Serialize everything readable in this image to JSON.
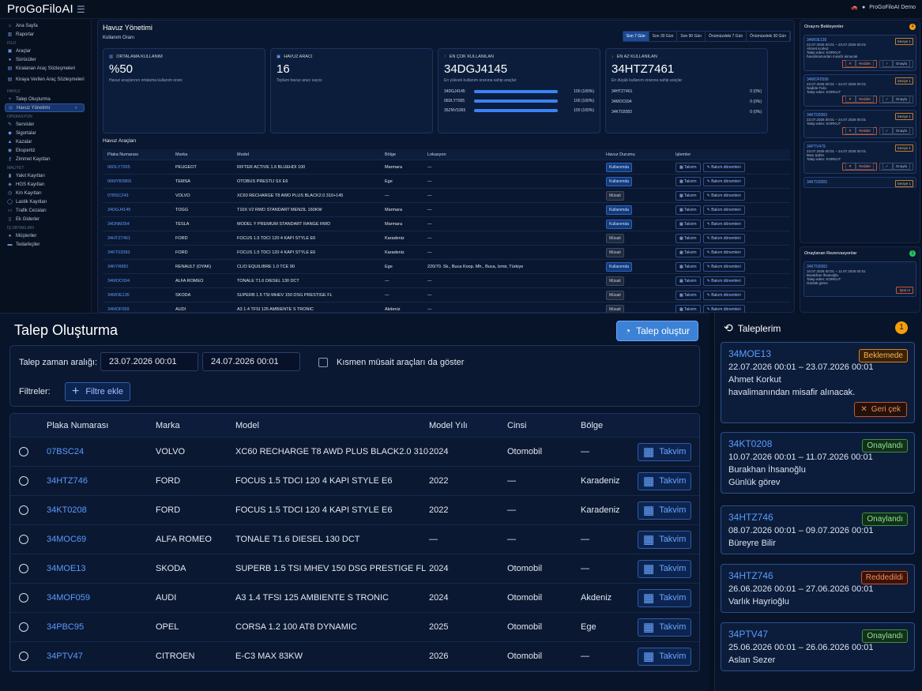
{
  "app": {
    "brand": "ProGoFiloAI",
    "user": "ProGoFiloAI Demo"
  },
  "sidebar": {
    "items": [
      {
        "type": "item",
        "label": "Ana Sayfa",
        "icon": "home-icon"
      },
      {
        "type": "item",
        "label": "Raporlar",
        "icon": "chart-icon"
      },
      {
        "type": "section",
        "label": "FİLO"
      },
      {
        "type": "item",
        "label": "Araçlar",
        "icon": "car-icon"
      },
      {
        "type": "item",
        "label": "Sürücüler",
        "icon": "user-icon"
      },
      {
        "type": "item",
        "label": "Kiralanan Araç Sözleşmeleri",
        "icon": "doc-icon"
      },
      {
        "type": "item2",
        "label": "Kiraya Verilen Araç Sözleşmeleri",
        "icon": "doc-icon"
      },
      {
        "type": "section",
        "label": "HAVUZ"
      },
      {
        "type": "item",
        "label": "Talep Oluşturma",
        "icon": "plus-icon"
      },
      {
        "type": "active",
        "label": "Havuz Yönetimi",
        "icon": "pool-icon"
      },
      {
        "type": "section",
        "label": "OPERASYON"
      },
      {
        "type": "item",
        "label": "Servisler",
        "icon": "wrench-icon"
      },
      {
        "type": "item",
        "label": "Sigortalar",
        "icon": "shield-icon"
      },
      {
        "type": "item",
        "label": "Kazalar",
        "icon": "alert-icon"
      },
      {
        "type": "item",
        "label": "Ekspertiz",
        "icon": "search-icon"
      },
      {
        "type": "item",
        "label": "Zimmet Kayıtları",
        "icon": "key-icon"
      },
      {
        "type": "section",
        "label": "MALİYET"
      },
      {
        "type": "item",
        "label": "Yakıt Kayıtları",
        "icon": "fuel-icon"
      },
      {
        "type": "item",
        "label": "HGS Kayıtları",
        "icon": "toll-icon"
      },
      {
        "type": "item",
        "label": "Km Kayıtları",
        "icon": "gauge-icon"
      },
      {
        "type": "item",
        "label": "Lastik Kayıtları",
        "icon": "tire-icon"
      },
      {
        "type": "item",
        "label": "Trafik Cezaları",
        "icon": "ticket-icon"
      },
      {
        "type": "item",
        "label": "Ek Giderler",
        "icon": "receipt-icon"
      },
      {
        "type": "section",
        "label": "İŞ ORTAKLARI"
      },
      {
        "type": "item",
        "label": "Müşteriler",
        "icon": "users-icon"
      },
      {
        "type": "item",
        "label": "Tedarikçiler",
        "icon": "truck-icon"
      }
    ]
  },
  "havuz": {
    "title": "Havuz Yönetimi",
    "subtitle": "Kullanım Oranı",
    "ranges": [
      "Son 7 Gün",
      "Son 30 Gün",
      "Son 90 Gün",
      "Önümüzdeki 7 Gün",
      "Önümüzdeki 30 Gün"
    ],
    "cards": [
      {
        "label": "ORTALAMA KULLANIM",
        "value": "%50",
        "sub": "Havuz araçlarının ortalama kullanım oranı",
        "icon": "bars-icon"
      },
      {
        "label": "HAVUZ ARACI",
        "value": "16",
        "sub": "Toplam havuz aracı sayısı",
        "icon": "car-icon"
      },
      {
        "label": "EN ÇOK KULLANILAN",
        "value": "34DGJ4145",
        "sub": "En yüksek kullanım oranına sahip araçlar",
        "icon": "arrow-up-icon"
      },
      {
        "label": "EN AZ KULLANILAN",
        "value": "34HTZ7461",
        "sub": "En düşük kullanım oranına sahip araçlar",
        "icon": "arrow-down-icon"
      }
    ],
    "top": [
      {
        "plate": "34DGJ4145",
        "pct": 100,
        "label": "100 (100%)"
      },
      {
        "plate": "06DLY7005",
        "pct": 100,
        "label": "100 (100%)"
      },
      {
        "plate": "35ZNVS365",
        "pct": 100,
        "label": "100 (100%)"
      }
    ],
    "low": [
      {
        "plate": "34HTZ7461",
        "label": "0 (0%)"
      },
      {
        "plate": "34MOC694",
        "label": "0 (0%)"
      },
      {
        "plate": "34KT02083",
        "label": "0 (0%)"
      }
    ],
    "table_title": "Havuz Araçları",
    "headers": [
      "Plaka Numarası",
      "Marka",
      "Model",
      "Bölge",
      "Lokasyon",
      "Havuz Durumu",
      "İşlemler"
    ],
    "btn_cal": "Takvim",
    "btn_maint": "Bakım dönemleri",
    "rows": [
      {
        "plate": "06DLY7005",
        "brand": "PEUGEOT",
        "model": "RIFTER ACTIVE 1.6 BLUEHDI 100",
        "region": "Marmara",
        "loc": "—",
        "status": "Kullanımda",
        "s": "k"
      },
      {
        "plate": "06MYB3865",
        "brand": "TEMSA",
        "model": "OTOBÜS PRESTIJ SX E6",
        "region": "Ege",
        "loc": "—",
        "status": "Kullanımda",
        "s": "k"
      },
      {
        "plate": "07BSC243",
        "brand": "VOLVO",
        "model": "XC60 RECHARGE T8 AWD PLUS BLACK2.0 310+145",
        "region": "—",
        "loc": "—",
        "status": "Müsait",
        "s": "m"
      },
      {
        "plate": "34DGJ4145",
        "brand": "TOGG",
        "model": "T10X V2 RWD STANDART MENZIL 160KW",
        "region": "Marmara",
        "loc": "—",
        "status": "Kullanımda",
        "s": "k"
      },
      {
        "plate": "34DNM354",
        "brand": "TESLA",
        "model": "MODEL Y PREMIUM STANDART RANGE RWD",
        "region": "Marmara",
        "loc": "—",
        "status": "Kullanımda",
        "s": "k"
      },
      {
        "plate": "34HTZ7461",
        "brand": "FORD",
        "model": "FOCUS 1.5 TDCI 120 4 KAPI STYLE E6",
        "region": "Karadeniz",
        "loc": "—",
        "status": "Müsait",
        "s": "m"
      },
      {
        "plate": "34KT02083",
        "brand": "FORD",
        "model": "FOCUS 1.5 TDCI 120 4 KAPI STYLE E6",
        "region": "Karadeniz",
        "loc": "—",
        "status": "Müsait",
        "s": "m"
      },
      {
        "plate": "34KYR881",
        "brand": "RENAULT (OYAK)",
        "model": "CLIO EQUILIBRE 1.0 TCE 90",
        "region": "Ege",
        "loc": "220/70. Sk., Buca Koop. Mh., Buca, İzmir, Türkiye",
        "status": "Kullanımda",
        "s": "k"
      },
      {
        "plate": "34MOC694",
        "brand": "ALFA ROMEO",
        "model": "TONALE T1.6 DIESEL 130 DCT",
        "region": "—",
        "loc": "—",
        "status": "Müsait",
        "s": "m"
      },
      {
        "plate": "34MOE135",
        "brand": "SKODA",
        "model": "SUPERB 1.5 TSI MHEV 150 DSG PRESTIGE FL",
        "region": "—",
        "loc": "—",
        "status": "Müsait",
        "s": "m"
      },
      {
        "plate": "34MOF059",
        "brand": "AUDI",
        "model": "A3 1.4 TFSI 125 AMBIENTE S TRONIC",
        "region": "Akdeniz",
        "loc": "—",
        "status": "Müsait",
        "s": "m"
      }
    ]
  },
  "side": {
    "pending_title": "Onayını Bekleyenler",
    "pending_count": "4",
    "pending": [
      {
        "plate": "34MOE135",
        "tag": "Seviye 1",
        "l1": "22.07.2026 00:01 – 23.07.2026 00:01",
        "l2": "Ahmet Korkut",
        "l3": "Talep eden: KORKUT",
        "l4": "havalimanından misafir alınacak."
      },
      {
        "plate": "34MOF0596",
        "tag": "Seviye 1",
        "l1": "23.07.2026 00:01 – 24.07.2026 00:01",
        "l2": "Nadide Falcı",
        "l3": "Talep eden: KORKUT",
        "l4": ""
      },
      {
        "plate": "34KT02083",
        "tag": "Seviye 1",
        "l1": "23.07.2026 00:01 – 24.07.2026 00:01",
        "l2": "Talep eden: KORKUT",
        "l3": "",
        "l4": ""
      },
      {
        "plate": "34PTV479",
        "tag": "Seviye 1",
        "l1": "23.07.2026 00:01 – 24.07.2026 00:01",
        "l2": "Batu Şahin",
        "l3": "Talep eden: KORKUT",
        "l4": ""
      },
      {
        "plate": "34KT02083",
        "tag": "Seviye 1",
        "l1": "",
        "l2": "",
        "l3": "",
        "l4": ""
      }
    ],
    "reject": "Reddet",
    "approve": "Onayla",
    "approved_title": "Onaylanan Rezervasyonlar",
    "approved_count": "1",
    "approved": {
      "plate": "34KT02083",
      "l1": "10.07.2026 00:01 – 11.07.2026 00:01",
      "l2": "Burakhan İhsanoğlu",
      "l3": "Talep eden: KORKUT",
      "l4": "Günlük görev",
      "cancel": "İptal et"
    }
  },
  "talep": {
    "title": "Talep Oluşturma",
    "create_btn": "Talep oluştur",
    "range_label": "Talep zaman aralığı:",
    "start": "23.07.2026 00:01",
    "end": "24.07.2026 00:01",
    "partial_label": "Kısmen müsait araçları da göster",
    "filters_label": "Filtreler:",
    "add_filter": "Filtre ekle",
    "headers": [
      "Plaka Numarası",
      "Marka",
      "Model",
      "Model Yılı",
      "Cinsi",
      "Bölge"
    ],
    "btn": "Takvim",
    "rows": [
      {
        "plate": "07BSC24",
        "brand": "VOLVO",
        "model": "XC60 RECHARGE T8 AWD PLUS BLACK2.0 310+145",
        "year": "2024",
        "kind": "Otomobil",
        "region": "—"
      },
      {
        "plate": "34HTZ746",
        "brand": "FORD",
        "model": "FOCUS 1.5 TDCI 120 4 KAPI STYLE E6",
        "year": "2022",
        "kind": "—",
        "region": "Karadeniz"
      },
      {
        "plate": "34KT0208",
        "brand": "FORD",
        "model": "FOCUS 1.5 TDCI 120 4 KAPI STYLE E6",
        "year": "2022",
        "kind": "—",
        "region": "Karadeniz"
      },
      {
        "plate": "34MOC69",
        "brand": "ALFA ROMEO",
        "model": "TONALE T1.6 DIESEL 130 DCT",
        "year": "—",
        "kind": "—",
        "region": "—"
      },
      {
        "plate": "34MOE13",
        "brand": "SKODA",
        "model": "SUPERB 1.5 TSI MHEV 150 DSG PRESTIGE FL",
        "year": "2024",
        "kind": "Otomobil",
        "region": "—"
      },
      {
        "plate": "34MOF059",
        "brand": "AUDI",
        "model": "A3 1.4 TFSI 125 AMBIENTE S TRONIC",
        "year": "2024",
        "kind": "Otomobil",
        "region": "Akdeniz"
      },
      {
        "plate": "34PBC95",
        "brand": "OPEL",
        "model": "CORSA 1.2 100 AT8 DYNAMIC",
        "year": "2025",
        "kind": "Otomobil",
        "region": "Ege"
      },
      {
        "plate": "34PTV47",
        "brand": "CITROEN",
        "model": "E-C3 MAX 83KW",
        "year": "2026",
        "kind": "Otomobil",
        "region": "—"
      }
    ]
  },
  "mine": {
    "title": "Taleplerim",
    "count": "1",
    "cards": [
      {
        "plate": "34MOE13",
        "status": "Beklemede",
        "s": "wait",
        "lines": [
          "22.07.2026 00:01 – 23.07.2026 00:01",
          "Ahmet Korkut",
          "havalimanından misafir alınacak."
        ],
        "action": "Geri çek"
      },
      {
        "plate": "34KT0208",
        "status": "Onaylandı",
        "s": "ok",
        "lines": [
          "10.07.2026 00:01 – 11.07.2026 00:01",
          "Burakhan İhsanoğlu",
          "Günlük görev"
        ]
      },
      {
        "plate": "34HTZ746",
        "status": "Onaylandı",
        "s": "ok",
        "lines": [
          "08.07.2026 00:01 – 09.07.2026 00:01",
          "Büreyre Bilir"
        ]
      },
      {
        "plate": "34HTZ746",
        "status": "Reddedildi",
        "s": "rej",
        "lines": [
          "26.06.2026 00:01 – 27.06.2026 00:01",
          "Varlık Hayrioğlu"
        ]
      },
      {
        "plate": "34PTV47",
        "status": "Onaylandı",
        "s": "ok",
        "lines": [
          "25.06.2026 00:01 – 26.06.2026 00:01",
          "Aslan Sezer"
        ]
      }
    ]
  }
}
